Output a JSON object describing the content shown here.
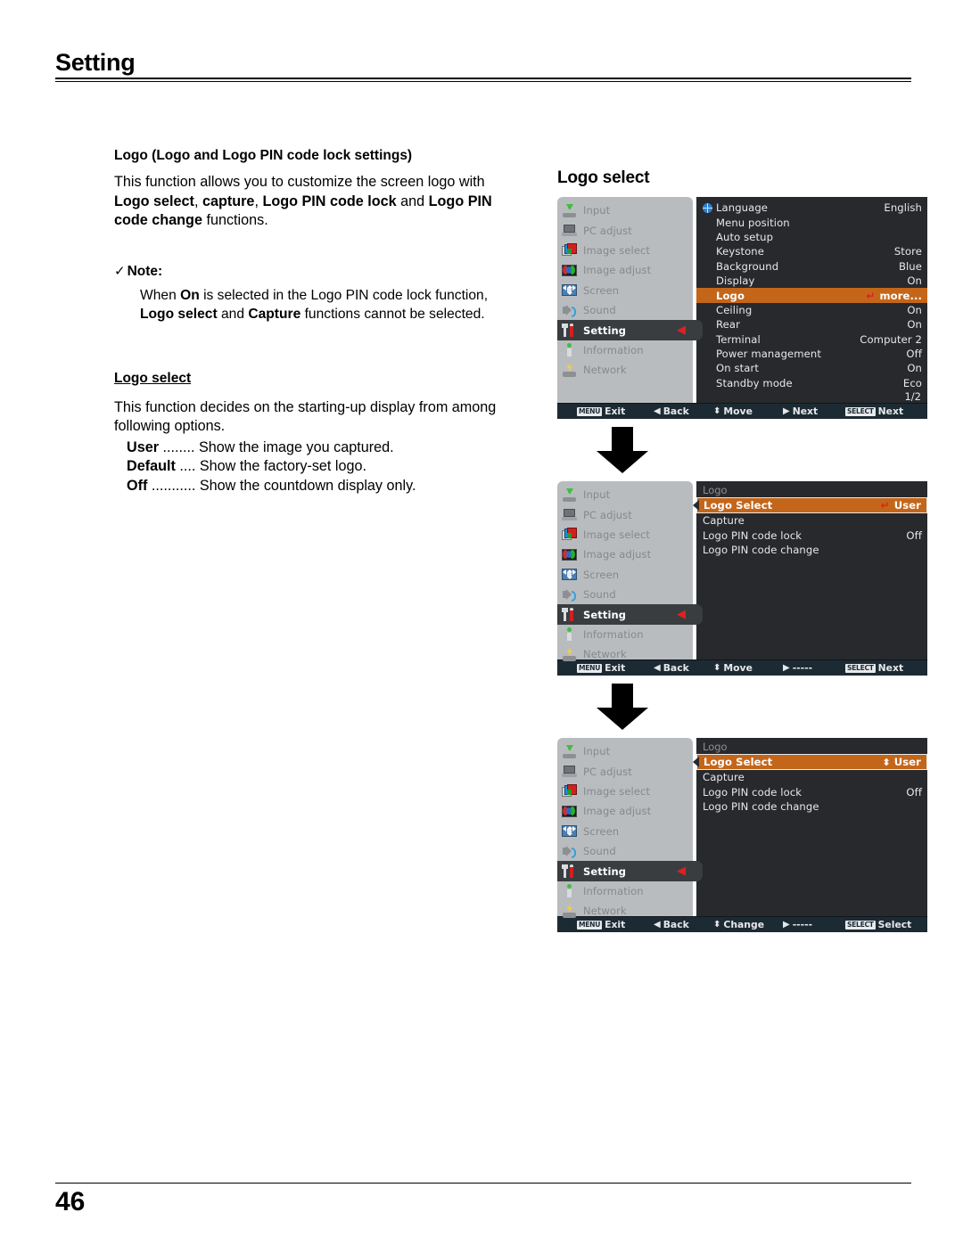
{
  "header": {
    "title": "Setting"
  },
  "footer": {
    "page_number": "46"
  },
  "left_column": {
    "section_title": "Logo (Logo and Logo PIN code lock settings)",
    "intro_line1_a": "This function allows you to customize the screen logo with ",
    "intro_line2_b1": "Logo select",
    "intro_line2_t1": ", ",
    "intro_line2_b2": "capture",
    "intro_line2_t2": ", ",
    "intro_line2_b3": "Logo PIN code lock",
    "intro_line2_t3": " and ",
    "intro_line2_b4": "Logo PIN",
    "intro_line3_b": "code change",
    "intro_line3_t": " functions.",
    "note": {
      "check_glyph": "✓",
      "label": "Note:",
      "line1_a": "When ",
      "line1_b": "On",
      "line1_c": " is selected in the Logo PIN code lock function,",
      "line2_b1": "Logo select",
      "line2_t1": " and ",
      "line2_b2": "Capture",
      "line2_t2": " functions cannot be selected."
    },
    "sub_head": "Logo select",
    "sub_para": "This function decides on the starting-up display from among following options.",
    "options": [
      {
        "term": "User",
        "dots": " ........ ",
        "desc": "Show the image you captured."
      },
      {
        "term": "Default",
        "dots": " .... ",
        "desc": "Show the factory-set logo."
      },
      {
        "term": "Off",
        "dots": " ........... ",
        "desc": "Show the countdown display only."
      }
    ]
  },
  "right_column": {
    "figure_title": "Logo select"
  },
  "colors": {
    "highlight_orange": "#c4661a",
    "sidebar_gray": "#b9bcbf",
    "panel_dark": "#27292c",
    "active_row_dark": "#3a3d40",
    "bar_dark": "#1c2a33",
    "red_marker": "#e02020"
  },
  "sidebar_items": [
    {
      "label": "Input",
      "icon": "input-icon",
      "active": false
    },
    {
      "label": "PC adjust",
      "icon": "pc-adjust-icon",
      "active": false
    },
    {
      "label": "Image select",
      "icon": "image-select-icon",
      "active": false
    },
    {
      "label": "Image adjust",
      "icon": "image-adjust-icon",
      "active": false
    },
    {
      "label": "Screen",
      "icon": "screen-icon",
      "active": false
    },
    {
      "label": "Sound",
      "icon": "sound-icon",
      "active": false
    },
    {
      "label": "Setting",
      "icon": "setting-icon",
      "active": true
    },
    {
      "label": "Information",
      "icon": "information-icon",
      "active": false
    },
    {
      "label": "Network",
      "icon": "network-icon",
      "active": false
    }
  ],
  "osd_1": {
    "rows": [
      {
        "label": "Language",
        "value": "English",
        "globe": true,
        "highlight": false
      },
      {
        "label": "Menu position",
        "value": "",
        "globe": false,
        "highlight": false
      },
      {
        "label": "Auto setup",
        "value": "",
        "globe": false,
        "highlight": false
      },
      {
        "label": "Keystone",
        "value": "Store",
        "globe": false,
        "highlight": false
      },
      {
        "label": "Background",
        "value": "Blue",
        "globe": false,
        "highlight": false
      },
      {
        "label": "Display",
        "value": "On",
        "globe": false,
        "highlight": false
      },
      {
        "label": "Logo",
        "value": "more...",
        "globe": false,
        "highlight": true,
        "marker": "return"
      },
      {
        "label": "Ceiling",
        "value": "On",
        "globe": false,
        "highlight": false
      },
      {
        "label": "Rear",
        "value": "On",
        "globe": false,
        "highlight": false
      },
      {
        "label": "Terminal",
        "value": "Computer 2",
        "globe": false,
        "highlight": false
      },
      {
        "label": "Power management",
        "value": "Off",
        "globe": false,
        "highlight": false
      },
      {
        "label": "On start",
        "value": "On",
        "globe": false,
        "highlight": false
      },
      {
        "label": "Standby mode",
        "value": "Eco",
        "globe": false,
        "highlight": false
      }
    ],
    "page_indicator": "1/2",
    "bar": {
      "exit_key": "MENU",
      "exit_label": "Exit",
      "back_glyph": "◀",
      "back_label": "Back",
      "move_glyph": "⬍",
      "move_label": "Move",
      "next_glyph": "▶",
      "next_label": "Next",
      "select_key": "SELECT",
      "select_label": "Next"
    }
  },
  "osd_2": {
    "panel_title": "Logo",
    "rows": [
      {
        "label": "Logo Select",
        "value": "User",
        "highlight": true,
        "marker": "return"
      },
      {
        "label": "Capture",
        "value": "",
        "highlight": false
      },
      {
        "label": "Logo PIN code lock",
        "value": "Off",
        "highlight": false
      },
      {
        "label": "Logo PIN code change",
        "value": "",
        "highlight": false
      }
    ],
    "bar": {
      "exit_key": "MENU",
      "exit_label": "Exit",
      "back_glyph": "◀",
      "back_label": "Back",
      "move_glyph": "⬍",
      "move_label": "Move",
      "next_glyph": "▶",
      "next_label": "-----",
      "select_key": "SELECT",
      "select_label": "Next"
    }
  },
  "osd_3": {
    "panel_title": "Logo",
    "rows": [
      {
        "label": "Logo Select",
        "value": "User",
        "highlight": true,
        "marker": "updown"
      },
      {
        "label": "Capture",
        "value": "",
        "highlight": false
      },
      {
        "label": "Logo PIN code lock",
        "value": "Off",
        "highlight": false
      },
      {
        "label": "Logo PIN code change",
        "value": "",
        "highlight": false
      }
    ],
    "bar": {
      "exit_key": "MENU",
      "exit_label": "Exit",
      "back_glyph": "◀",
      "back_label": "Back",
      "move_glyph": "⬍",
      "move_label": "Change",
      "next_glyph": "▶",
      "next_label": "-----",
      "select_key": "SELECT",
      "select_label": "Select"
    }
  }
}
